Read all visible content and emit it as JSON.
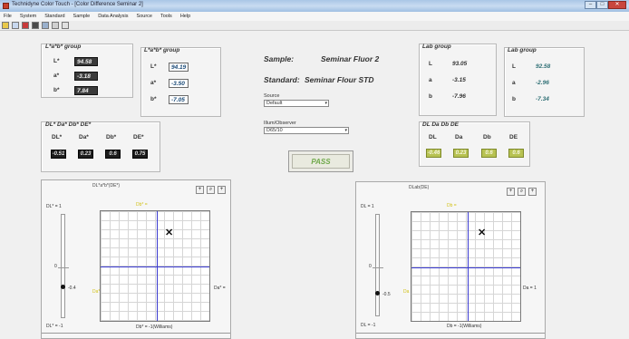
{
  "titlebar": {
    "title": "Technidyne Color Touch - [Color Difference Seminar 2]"
  },
  "menu": [
    "File",
    "System",
    "Standard",
    "Sample",
    "Data Analysis",
    "Source",
    "Tools",
    "Help"
  ],
  "toolbar": {
    "icons": [
      "open-icon",
      "save-icon",
      "chart-icon",
      "print-icon",
      "report-icon",
      "grid-icon",
      "settings-icon"
    ]
  },
  "lab_star_group": {
    "title": "L*a*b* group",
    "rows": [
      {
        "label": "L*",
        "value": "94.58"
      },
      {
        "label": "a*",
        "value": "-3.18"
      },
      {
        "label": "b*",
        "value": "7.84"
      }
    ]
  },
  "lab_star_group2": {
    "title": "L*a*b* group",
    "rows": [
      {
        "label": "L*",
        "value": "94.19"
      },
      {
        "label": "a*",
        "value": "-3.50"
      },
      {
        "label": "b*",
        "value": "-7.05"
      }
    ]
  },
  "sample": {
    "label": "Sample:",
    "value": "Seminar Fluor 2"
  },
  "standard": {
    "label": "Standard:",
    "value": "Seminar Flour STD"
  },
  "source": {
    "label": "Source",
    "value": "Default"
  },
  "illum": {
    "label": "Illum/Observer",
    "value": "D65/10"
  },
  "lab_group": {
    "title": "Lab group",
    "rows": [
      {
        "label": "L",
        "value": "93.05"
      },
      {
        "label": "a",
        "value": "-3.15"
      },
      {
        "label": "b",
        "value": "-7.96"
      }
    ]
  },
  "lab_group2": {
    "title": "Lab group",
    "rows": [
      {
        "label": "L",
        "value": "92.58"
      },
      {
        "label": "a",
        "value": "-2.96"
      },
      {
        "label": "b",
        "value": "-7.34"
      }
    ]
  },
  "delta_star": {
    "title": "DL* Da* Db* DE*",
    "headers": [
      "DL*",
      "Da*",
      "Db*",
      "DE*"
    ],
    "values": [
      "-0.51",
      "0.23",
      "0.6",
      "0.75"
    ]
  },
  "delta": {
    "title": "DL Da Db DE",
    "headers": [
      "DL",
      "Da",
      "Db",
      "DE"
    ],
    "values": [
      "-0.46",
      "0.23",
      "0.6",
      "0.6"
    ]
  },
  "pass": "PASS",
  "plot_left": {
    "title": "DL*a*b*(DE*)",
    "top_tick": "DL* = 1",
    "bottom_tick": "DL* = -1",
    "mid_tick": "0",
    "dot_label": "-0.4",
    "x_left": "Da*",
    "x_right": "Da* =",
    "b_top": "Db* = ",
    "b_bottom": "Db* = -1(Williams)"
  },
  "plot_right": {
    "title": "DLab(DE)",
    "top_tick": "DL = 1",
    "bottom_tick": "DL = -1",
    "mid_tick": "0",
    "dot_label": "-0.5",
    "x_left": "Da",
    "x_right": "Da = 1",
    "b_top": "Db = ",
    "b_bottom": "Db = -1(Williams)"
  },
  "plot_buttons": {
    "plus": "+",
    "zoom": "⌕",
    "add": "+"
  },
  "marker": "✕"
}
